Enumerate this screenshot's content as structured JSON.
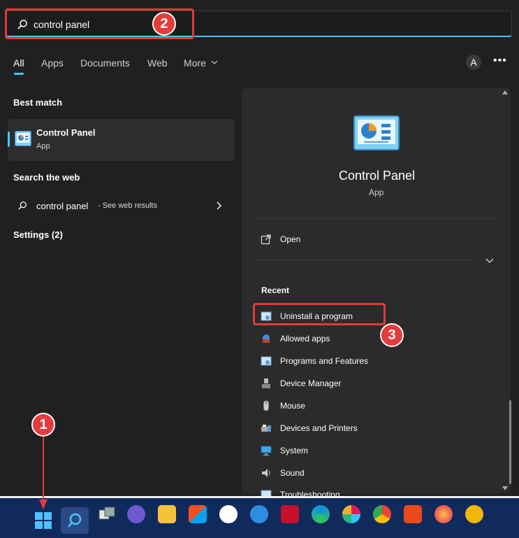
{
  "search": {
    "query": "control panel"
  },
  "tabs": [
    "All",
    "Apps",
    "Documents",
    "Web",
    "More"
  ],
  "user_initial": "A",
  "best_match": {
    "header": "Best match",
    "title": "Control Panel",
    "subtitle": "App"
  },
  "web": {
    "header": "Search the web",
    "query": "control panel",
    "suffix": " - See web results"
  },
  "settings": {
    "header": "Settings (2)"
  },
  "panel": {
    "title": "Control Panel",
    "subtitle": "App",
    "open_label": "Open",
    "recent_header": "Recent",
    "recent": [
      "Uninstall a program",
      "Allowed apps",
      "Programs and Features",
      "Device Manager",
      "Mouse",
      "Devices and Printers",
      "System",
      "Sound",
      "Troubleshooting"
    ]
  },
  "badges": [
    "1",
    "2",
    "3"
  ],
  "colors": {
    "accent": "#4cc2ff",
    "annotation": "#e63b3b",
    "taskbar": "#102a5c"
  }
}
